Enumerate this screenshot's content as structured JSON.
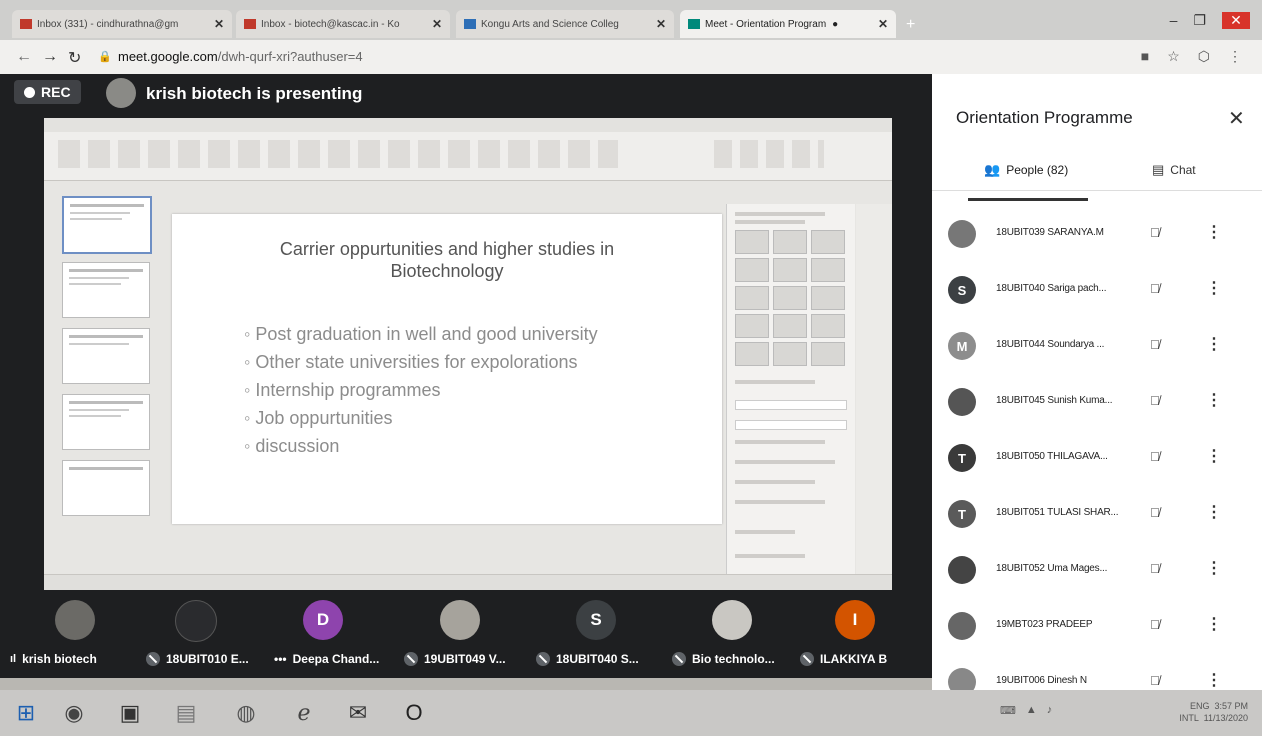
{
  "browser": {
    "tabs": [
      {
        "label": "Inbox (331) - cindhurathna@gm",
        "icon": "gmail-icon",
        "active": false
      },
      {
        "label": "Inbox - biotech@kascac.in - Ko",
        "icon": "gmail-icon",
        "active": false
      },
      {
        "label": "Kongu Arts and Science Colleg",
        "icon": "college-icon",
        "active": false
      },
      {
        "label": "Meet - Orientation Program",
        "icon": "meet-icon",
        "active": true
      }
    ],
    "url_domain": "meet.google.com",
    "url_path": "/dwh-qurf-xri?authuser=4"
  },
  "meeting": {
    "rec_label": "REC",
    "presenter_text": "krish biotech is presenting"
  },
  "slide": {
    "title": "Carrier oppurtunities and higher studies in\nBiotechnology",
    "bullets": [
      "Post graduation in well and good university",
      "Other state universities for expolorations",
      "Internship programmes",
      "Job oppurtunities",
      "discussion"
    ]
  },
  "participants_strip": [
    {
      "label": "krish biotech",
      "avatar": "",
      "color": "#6b6a66",
      "mic": "speaking"
    },
    {
      "label": "18UBIT010 E...",
      "avatar": "",
      "color": "#2a2b2e",
      "mic": "muted"
    },
    {
      "label": "Deepa Chand...",
      "avatar": "D",
      "color": "#8e44ad",
      "mic": "more"
    },
    {
      "label": "19UBIT049 V...",
      "avatar": "",
      "color": "#a6a39c",
      "mic": "muted"
    },
    {
      "label": "18UBIT040 S...",
      "avatar": "S",
      "color": "#3c4043",
      "mic": "muted"
    },
    {
      "label": "Bio technolo...",
      "avatar": "",
      "color": "#c9c7c2",
      "mic": "muted"
    },
    {
      "label": "ILAKKIYA B",
      "avatar": "I",
      "color": "#d35400",
      "mic": "muted"
    }
  ],
  "panel": {
    "title": "Orientation Programme",
    "close": "✕",
    "people_tab": "People (82)",
    "chat_tab": "Chat",
    "people": [
      {
        "name": "18UBIT039 SARANYA.M",
        "avatar": "",
        "color": "#777"
      },
      {
        "name": "18UBIT040 Sariga pach...",
        "avatar": "S",
        "color": "#3c4043"
      },
      {
        "name": "18UBIT044 Soundarya ...",
        "avatar": "M",
        "color": "#8d8d8d"
      },
      {
        "name": "18UBIT045 Sunish Kuma...",
        "avatar": "",
        "color": "#555"
      },
      {
        "name": "18UBIT050 THILAGAVA...",
        "avatar": "T",
        "color": "#3a3a3a"
      },
      {
        "name": "18UBIT051 TULASI SHAR...",
        "avatar": "T",
        "color": "#5a5a5a"
      },
      {
        "name": "18UBIT052 Uma Mages...",
        "avatar": "",
        "color": "#444"
      },
      {
        "name": "19MBT023 PRADEEP",
        "avatar": "",
        "color": "#666"
      },
      {
        "name": "19UBIT006 Dinesh N",
        "avatar": "",
        "color": "#888"
      }
    ]
  },
  "taskbar": {
    "lang_top": "ENG",
    "lang_bottom": "INTL",
    "time": "3:57 PM",
    "date": "11/13/2020"
  }
}
